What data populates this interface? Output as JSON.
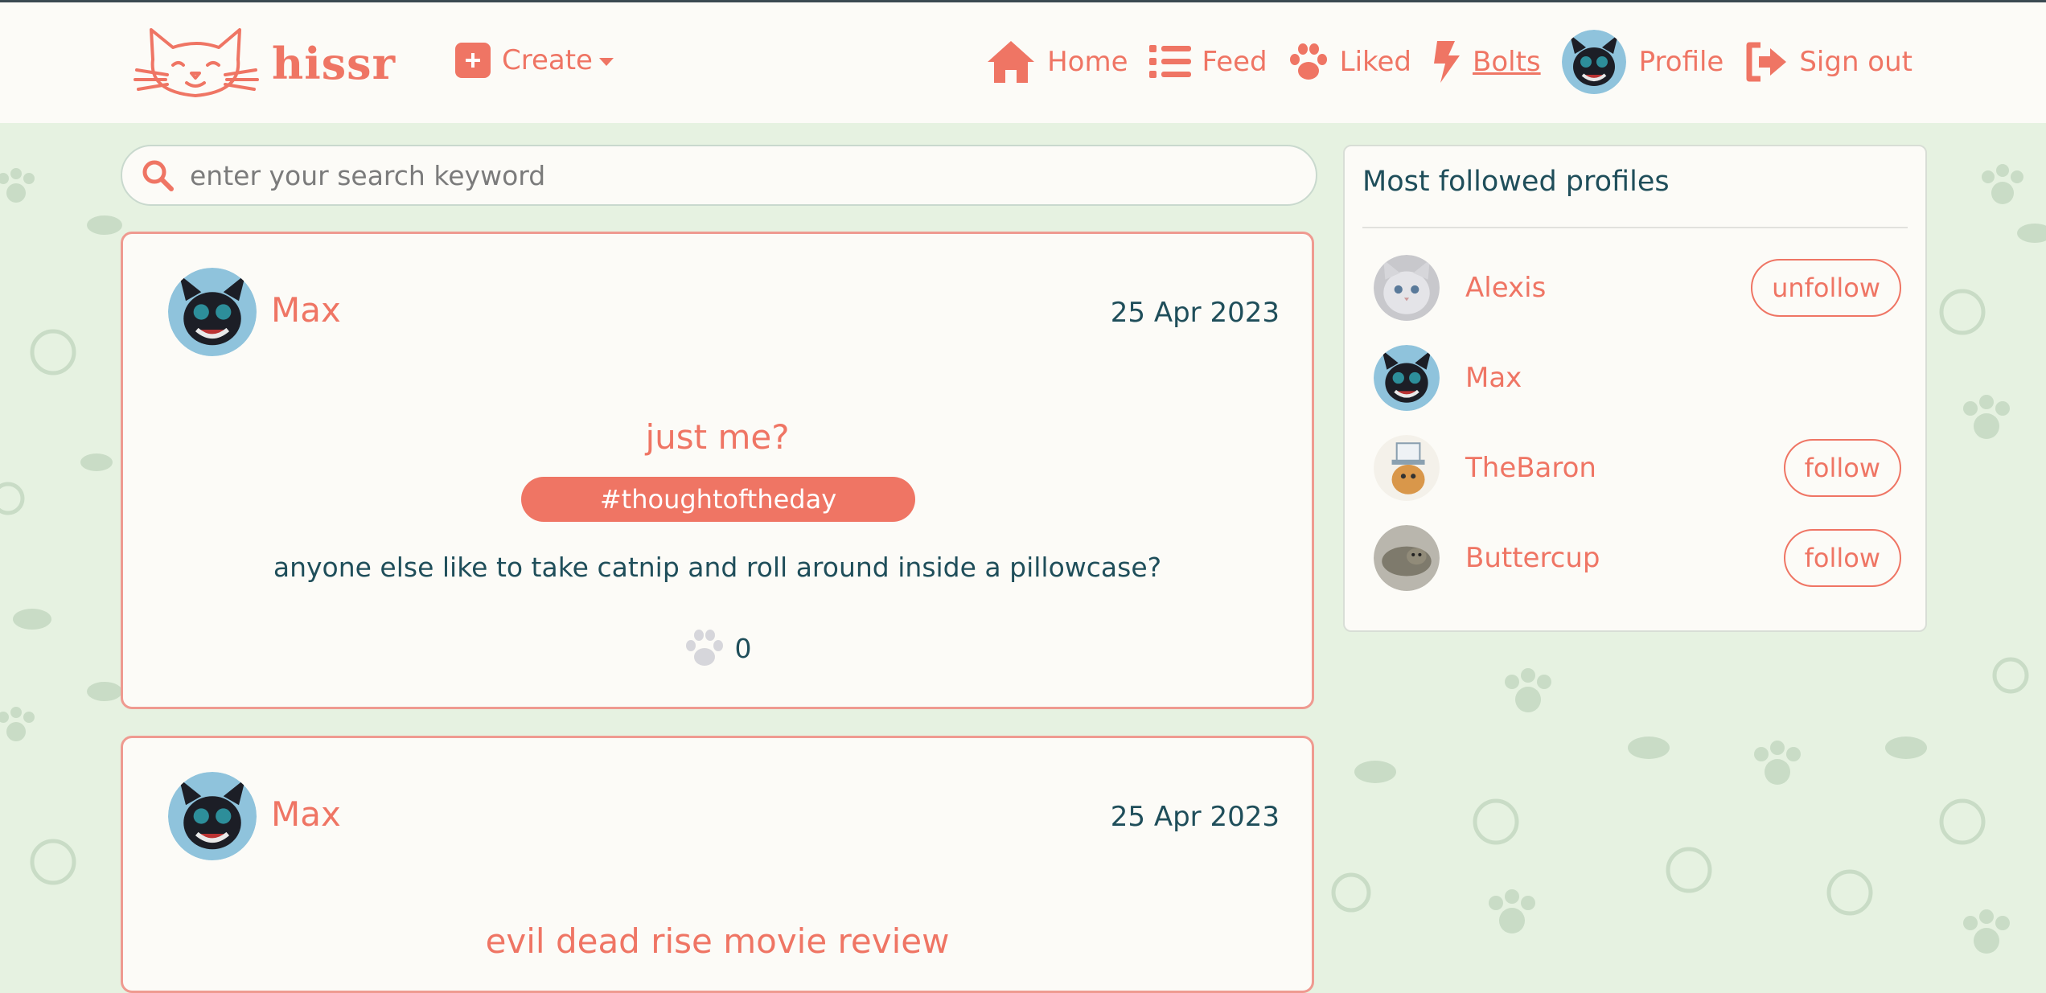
{
  "app": {
    "name": "hissr"
  },
  "nav": {
    "create_label": "Create",
    "home_label": "Home",
    "feed_label": "Feed",
    "liked_label": "Liked",
    "bolts_label": "Bolts",
    "profile_label": "Profile",
    "signout_label": "Sign out"
  },
  "search": {
    "placeholder": "enter your search keyword",
    "value": ""
  },
  "posts": [
    {
      "author": "Max",
      "date": "25 Apr 2023",
      "title": "just me?",
      "tag": "#thoughtoftheday",
      "body": "anyone else like to take catnip and roll around inside a pillowcase?",
      "likes": "0"
    },
    {
      "author": "Max",
      "date": "25 Apr 2023",
      "title": "evil dead rise movie review"
    }
  ],
  "sidebar": {
    "title": "Most followed profiles",
    "profiles": [
      {
        "name": "Alexis",
        "button": "unfollow"
      },
      {
        "name": "Max"
      },
      {
        "name": "TheBaron",
        "button": "follow"
      },
      {
        "name": "Buttercup",
        "button": "follow"
      }
    ]
  },
  "colors": {
    "accent": "#ef7564",
    "text": "#1f4e5a",
    "background": "#e6f2e1",
    "card": "#fcfbf7"
  },
  "icons": [
    "cat-logo-icon",
    "plus-square-icon",
    "home-icon",
    "list-icon",
    "paw-icon",
    "bolt-icon",
    "sign-out-icon",
    "search-icon"
  ]
}
